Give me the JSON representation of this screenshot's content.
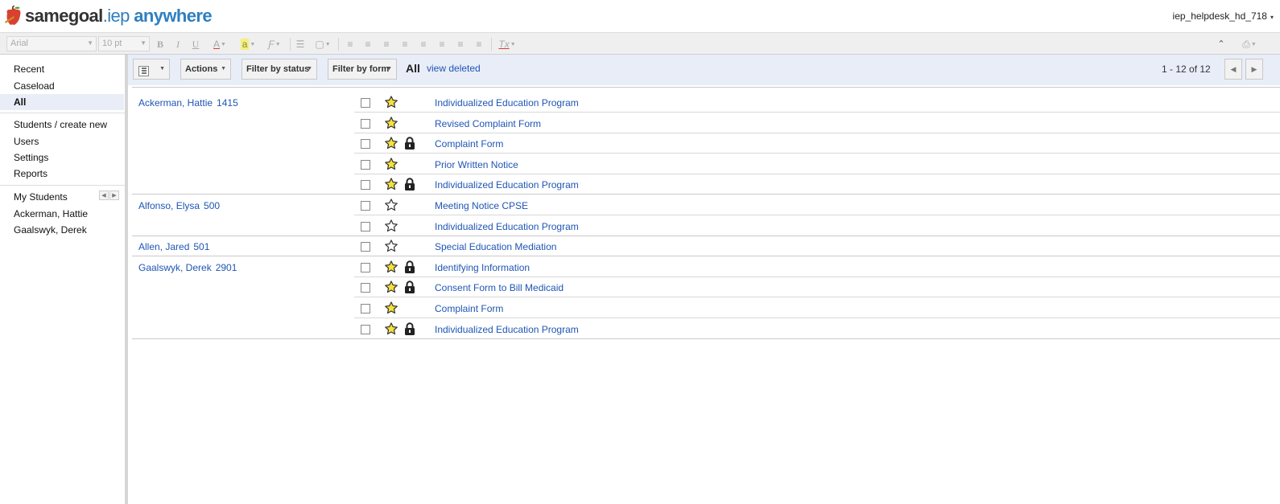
{
  "header": {
    "logo_part1": "samegoal",
    "logo_part2": ".iep",
    "logo_part3": "anywhere",
    "user": "iep_helpdesk_hd_718"
  },
  "toolbar": {
    "font": "Arial",
    "size": "10 pt",
    "bold": "B",
    "italic": "I",
    "underline": "U",
    "font_color": "A",
    "highlight": "a",
    "clear_format": "Tx"
  },
  "sidebar": {
    "items": [
      {
        "label": "Recent"
      },
      {
        "label": "Caseload"
      },
      {
        "label": "All"
      },
      {
        "label": "Students / create new"
      },
      {
        "label": "Users"
      },
      {
        "label": "Settings"
      },
      {
        "label": "Reports"
      },
      {
        "label": "My Students"
      },
      {
        "label": "Ackerman, Hattie"
      },
      {
        "label": "Gaalswyk, Derek"
      }
    ]
  },
  "actionbar": {
    "actions": "Actions",
    "filter_status": "Filter by status",
    "filter_form": "Filter by form",
    "current_filter": "All",
    "view_deleted": "view deleted",
    "count": "1 - 12 of 12"
  },
  "colors": {
    "link": "#1f55b4",
    "accent_bg": "#e8edf8",
    "star_fill": "#f5e13a",
    "logo_blue": "#2f7fc1"
  },
  "rows": [
    {
      "student": "Ackerman, Hattie",
      "id": "1415",
      "form": "Individualized Education Program",
      "starred": true,
      "locked": false,
      "group_start": true,
      "group_end": false
    },
    {
      "student": "",
      "id": "",
      "form": "Revised Complaint Form",
      "starred": true,
      "locked": false,
      "group_start": false,
      "group_end": false
    },
    {
      "student": "",
      "id": "",
      "form": "Complaint Form",
      "starred": true,
      "locked": true,
      "group_start": false,
      "group_end": false
    },
    {
      "student": "",
      "id": "",
      "form": "Prior Written Notice",
      "starred": true,
      "locked": false,
      "group_start": false,
      "group_end": false
    },
    {
      "student": "",
      "id": "",
      "form": "Individualized Education Program",
      "starred": true,
      "locked": true,
      "group_start": false,
      "group_end": true
    },
    {
      "student": "Alfonso, Elysa",
      "id": "500",
      "form": "Meeting Notice CPSE",
      "starred": false,
      "locked": false,
      "group_start": true,
      "group_end": false
    },
    {
      "student": "",
      "id": "",
      "form": "Individualized Education Program",
      "starred": false,
      "locked": false,
      "group_start": false,
      "group_end": true
    },
    {
      "student": "Allen, Jared",
      "id": "501",
      "form": "Special Education Mediation",
      "starred": false,
      "locked": false,
      "group_start": true,
      "group_end": true
    },
    {
      "student": "Gaalswyk, Derek",
      "id": "2901",
      "form": "Identifying Information",
      "starred": true,
      "locked": true,
      "group_start": true,
      "group_end": false
    },
    {
      "student": "",
      "id": "",
      "form": "Consent Form to Bill Medicaid",
      "starred": true,
      "locked": true,
      "group_start": false,
      "group_end": false
    },
    {
      "student": "",
      "id": "",
      "form": "Complaint Form",
      "starred": true,
      "locked": false,
      "group_start": false,
      "group_end": false
    },
    {
      "student": "",
      "id": "",
      "form": "Individualized Education Program",
      "starred": true,
      "locked": true,
      "group_start": false,
      "group_end": true
    }
  ]
}
